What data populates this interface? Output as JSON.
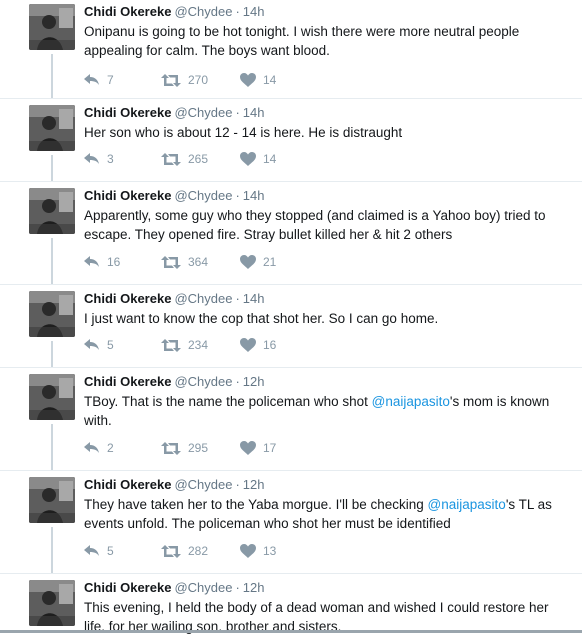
{
  "tweets": [
    {
      "name": "Chidi Okereke",
      "handle": "@Chydee",
      "dot": "·",
      "time": "14h",
      "segments": [
        {
          "t": "Onipanu is going to be hot tonight. I wish there were more neutral people appealing for calm. The boys want blood.",
          "mention": false
        }
      ],
      "replies": "7",
      "retweets": "270",
      "likes": "14"
    },
    {
      "name": "Chidi Okereke",
      "handle": "@Chydee",
      "dot": "·",
      "time": "14h",
      "segments": [
        {
          "t": "Her son who is about 12 - 14 is here. He is distraught",
          "mention": false
        }
      ],
      "replies": "3",
      "retweets": "265",
      "likes": "14"
    },
    {
      "name": "Chidi Okereke",
      "handle": "@Chydee",
      "dot": "·",
      "time": "14h",
      "segments": [
        {
          "t": "Apparently, some guy who they stopped (and claimed is a Yahoo boy) tried to escape. They opened fire. Stray bullet killed her & hit 2 others",
          "mention": false
        }
      ],
      "replies": "16",
      "retweets": "364",
      "likes": "21"
    },
    {
      "name": "Chidi Okereke",
      "handle": "@Chydee",
      "dot": "·",
      "time": "14h",
      "segments": [
        {
          "t": "I just want to know the cop that shot her. So I can go home.",
          "mention": false
        }
      ],
      "replies": "5",
      "retweets": "234",
      "likes": "16"
    },
    {
      "name": "Chidi Okereke",
      "handle": "@Chydee",
      "dot": "·",
      "time": "12h",
      "segments": [
        {
          "t": "TBoy. That is the name the policeman who shot ",
          "mention": false
        },
        {
          "t": "@naijapasito",
          "mention": true
        },
        {
          "t": "'s mom is known with.",
          "mention": false
        }
      ],
      "replies": "2",
      "retweets": "295",
      "likes": "17"
    },
    {
      "name": "Chidi Okereke",
      "handle": "@Chydee",
      "dot": "·",
      "time": "12h",
      "segments": [
        {
          "t": "They have taken her to the Yaba morgue. I'll be checking ",
          "mention": false
        },
        {
          "t": "@naijapasito",
          "mention": true
        },
        {
          "t": "'s TL as events unfold. The policeman who shot her must be identified",
          "mention": false
        }
      ],
      "replies": "5",
      "retweets": "282",
      "likes": "13"
    },
    {
      "name": "Chidi Okereke",
      "handle": "@Chydee",
      "dot": "·",
      "time": "12h",
      "segments": [
        {
          "t": "This evening, I held the body of a dead woman and wished I could restore her life, for her wailing son, brother and sisters.",
          "mention": false
        }
      ],
      "replies": "",
      "retweets": "",
      "likes": ""
    }
  ]
}
